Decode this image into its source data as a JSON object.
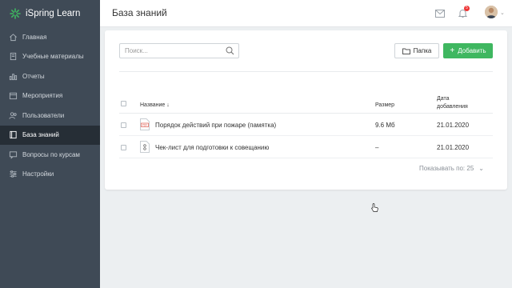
{
  "app": {
    "name": "iSpring Learn",
    "brand_color": "#3fb760"
  },
  "sidebar": {
    "items": [
      {
        "label": "Главная",
        "icon": "home-icon",
        "active": false
      },
      {
        "label": "Учебные материалы",
        "icon": "book-icon",
        "active": false
      },
      {
        "label": "Отчеты",
        "icon": "bar-chart-icon",
        "active": false
      },
      {
        "label": "Мероприятия",
        "icon": "calendar-icon",
        "active": false
      },
      {
        "label": "Пользователи",
        "icon": "users-icon",
        "active": false
      },
      {
        "label": "База знаний",
        "icon": "knowledge-base-icon",
        "active": true
      },
      {
        "label": "Вопросы по курсам",
        "icon": "chat-icon",
        "active": false
      },
      {
        "label": "Настройки",
        "icon": "sliders-icon",
        "active": false
      }
    ]
  },
  "header": {
    "title": "База знаний",
    "notification_count": "5"
  },
  "toolbar": {
    "search_placeholder": "Поиск...",
    "folder_label": "Папка",
    "add_label": "Добавить"
  },
  "table": {
    "columns": {
      "name": "Название ↓",
      "size": "Размер",
      "date_line1": "Дата",
      "date_line2": "добавления"
    },
    "rows": [
      {
        "name": "Порядок действий при пожаре (памятка)",
        "size": "9.6 Мб",
        "date": "21.01.2020",
        "type": "pdf"
      },
      {
        "name": "Чек-лист для подготовки к совещанию",
        "size": "–",
        "date": "21.01.2020",
        "type": "checklist"
      }
    ]
  },
  "pagination": {
    "label": "Показывать по: 25"
  }
}
